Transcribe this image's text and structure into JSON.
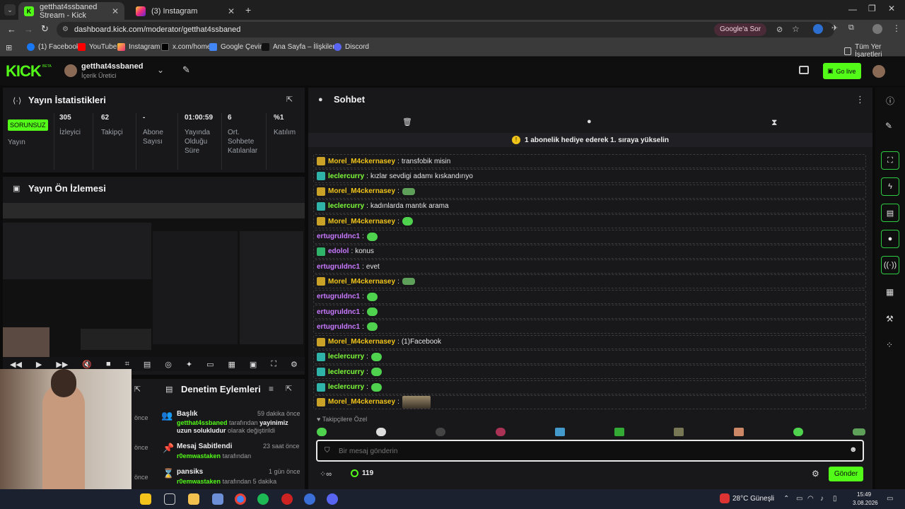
{
  "browser": {
    "tabs": [
      {
        "title": "getthat4ssbaned Stream - Kick"
      },
      {
        "title": "(3) Instagram"
      }
    ],
    "url": "dashboard.kick.com/moderator/getthat4ssbaned",
    "translate_button": "Google'a Sor",
    "bookmarks": [
      "(1) Facebook",
      "YouTube",
      "Instagram",
      "x.com/home",
      "Google Çeviri",
      "Ana Sayfa – İlişkiler...",
      "Discord"
    ],
    "bookmarks_right": "Tüm Yer İşaretleri"
  },
  "header": {
    "logo": "KICK",
    "logo_tag": "BETA",
    "channel_name": "getthat4ssbaned",
    "channel_role": "İçerik Üretici",
    "go_live": "Go live"
  },
  "stats": {
    "title": "Yayın İstatistikleri",
    "status_badge": "SORUNSUZ",
    "status_label": "Yayın",
    "items": [
      {
        "value": "305",
        "label": "İzleyici"
      },
      {
        "value": "62",
        "label": "Takipçi"
      },
      {
        "value": "-",
        "label": "Abone Sayısı"
      },
      {
        "value": "01:00:59",
        "label": "Yayında Olduğu Süre"
      },
      {
        "value": "6",
        "label": "Ort. Sohbete Katılanlar"
      },
      {
        "value": "%1",
        "label": "Katılım"
      }
    ]
  },
  "preview": {
    "title": "Yayın Ön İzlemesi"
  },
  "moderation": {
    "title": "Denetim Eylemleri",
    "items": [
      {
        "title": "Başlık",
        "time": "59 dakika önce",
        "actor": "getthat4ssbaned",
        "text1": "tarafından",
        "highlight": "yayinimiz uzun solukludur",
        "text2": "olarak değiştirildi"
      },
      {
        "title": "Mesaj Sabitlendi",
        "time": "23 saat önce",
        "actor": "r0emwastaken",
        "text1": "tarafından",
        "highlight": "",
        "text2": ""
      },
      {
        "title": "pansiks",
        "time": "1 gün önce",
        "actor": "r0emwastaken",
        "text1": "tarafından 5 dakika",
        "highlight": "",
        "text2": ""
      }
    ],
    "side_times": [
      "önce",
      "önce",
      "önce"
    ]
  },
  "chat": {
    "title": "Sohbet",
    "banner": "1 abonelik hediye ederek 1. sıraya yükselin",
    "messages": [
      {
        "user": "Morel_M4ckernasey",
        "color": "#f0c419",
        "badge": "#c9a227",
        "text": "transfobik misin",
        "emote": ""
      },
      {
        "user": "leclercurry",
        "color": "#7fff3a",
        "badge": "#2fb3a8",
        "text": "kızlar sevdigi adamı kıskandırıyo",
        "emote": ""
      },
      {
        "user": "Morel_M4ckernasey",
        "color": "#f0c419",
        "badge": "#c9a227",
        "text": "",
        "emote": "frog"
      },
      {
        "user": "leclercurry",
        "color": "#7fff3a",
        "badge": "#2fb3a8",
        "text": "kadınlarda mantık arama",
        "emote": ""
      },
      {
        "user": "Morel_M4ckernasey",
        "color": "#f0c419",
        "badge": "#c9a227",
        "text": "",
        "emote": "green"
      },
      {
        "user": "ertugruldnc1",
        "color": "#c879ff",
        "badge": "",
        "text": "",
        "emote": "green"
      },
      {
        "user": "edolol",
        "color": "#c879ff",
        "badge": "#2fb36a",
        "text": "konus",
        "emote": ""
      },
      {
        "user": "ertugruldnc1",
        "color": "#c879ff",
        "badge": "",
        "text": "evet",
        "emote": ""
      },
      {
        "user": "Morel_M4ckernasey",
        "color": "#f0c419",
        "badge": "#c9a227",
        "text": "",
        "emote": "frog"
      },
      {
        "user": "ertugruldnc1",
        "color": "#c879ff",
        "badge": "",
        "text": "",
        "emote": "green"
      },
      {
        "user": "ertugruldnc1",
        "color": "#c879ff",
        "badge": "",
        "text": "",
        "emote": "green"
      },
      {
        "user": "ertugruldnc1",
        "color": "#c879ff",
        "badge": "",
        "text": "",
        "emote": "green"
      },
      {
        "user": "Morel_M4ckernasey",
        "color": "#f0c419",
        "badge": "#c9a227",
        "text": "(1)Facebook",
        "emote": ""
      },
      {
        "user": "leclercurry",
        "color": "#7fff3a",
        "badge": "#2fb3a8",
        "text": "",
        "emote": "green"
      },
      {
        "user": "leclercurry",
        "color": "#7fff3a",
        "badge": "#2fb3a8",
        "text": "",
        "emote": "green"
      },
      {
        "user": "leclercurry",
        "color": "#7fff3a",
        "badge": "#2fb3a8",
        "text": "",
        "emote": "green"
      },
      {
        "user": "Morel_M4ckernasey",
        "color": "#f0c419",
        "badge": "#c9a227",
        "text": "",
        "emote": "img"
      }
    ],
    "followers_only": "Takipçilere Özel",
    "input_placeholder": "Bir mesaj gönderin",
    "viewer_count": "119",
    "send_button": "Gönder"
  },
  "taskbar": {
    "weather": "28°C  Güneşli",
    "time": "15:49",
    "date": "3.08.2026"
  }
}
